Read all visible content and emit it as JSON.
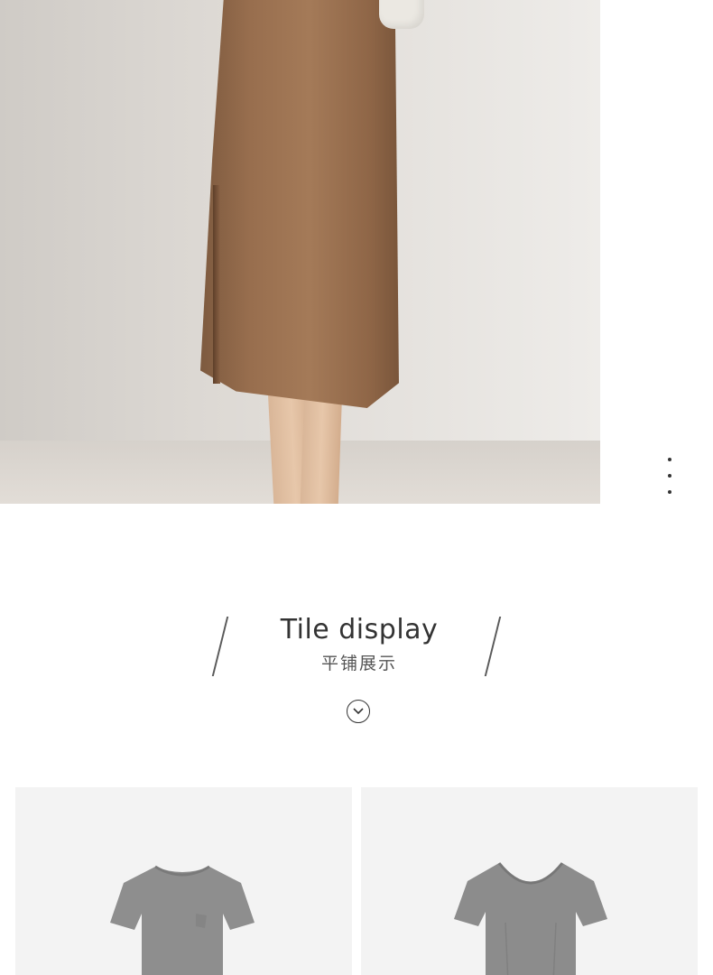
{
  "hero": {
    "image": "brown-midi-skirt-photo"
  },
  "menu": {
    "icon": "more-vertical-icon"
  },
  "section": {
    "title": "Tile display",
    "subtitle": "平铺展示",
    "expand_icon": "chevron-down-circle-icon"
  },
  "tiles": [
    {
      "image": "gray-tshirt-front"
    },
    {
      "image": "gray-tshirt-back"
    }
  ],
  "colors": {
    "skirt": "#986e4e",
    "tee": "#8d8d8d",
    "text": "#333333"
  }
}
